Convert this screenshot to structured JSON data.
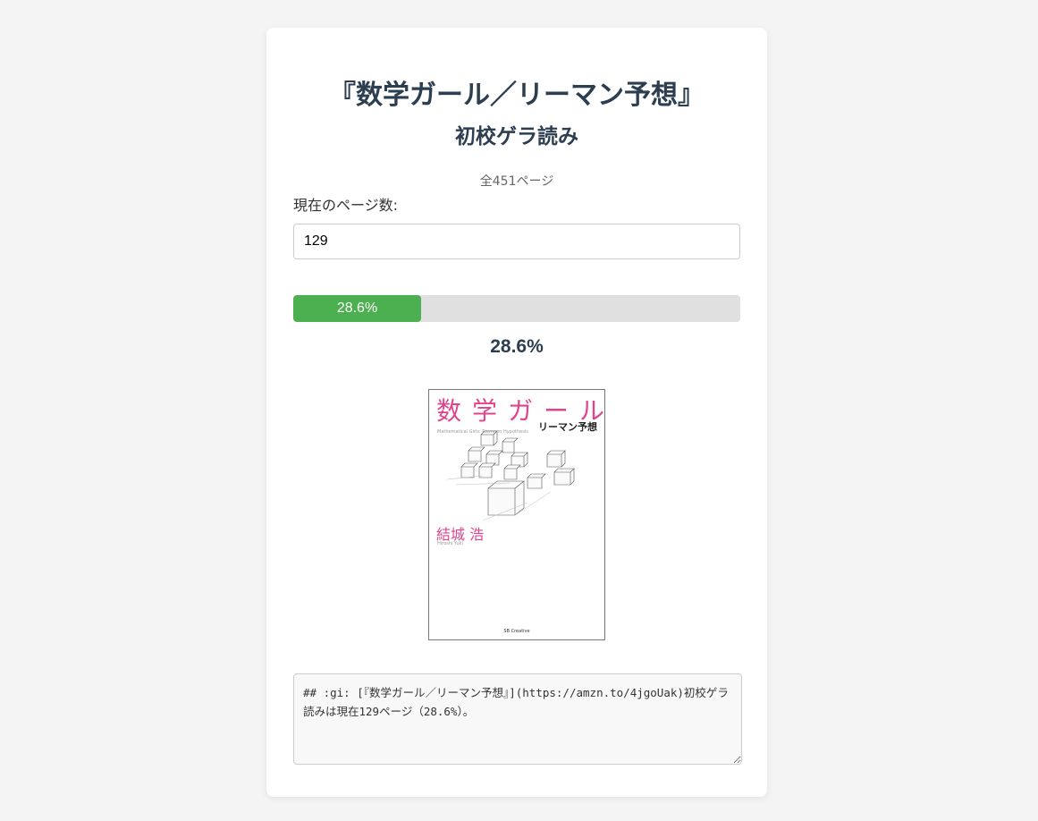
{
  "header": {
    "title": "『数学ガール／リーマン予想』",
    "subtitle": "初校ゲラ読み"
  },
  "book": {
    "total_pages_text": "全451ページ",
    "current_page_label": "現在のページ数:",
    "current_page_value": "129"
  },
  "progress": {
    "percent_value": 28.6,
    "bar_label": "28.6%",
    "percent_text": "28.6%"
  },
  "cover": {
    "title": "数学ガール",
    "subtitle": "リーマン予想",
    "title_en": "Mathematical Girls: Riemann Hypothesis",
    "author": "結城 浩",
    "author_en": "Hiroshi Yuki",
    "publisher": "SB Creative"
  },
  "output": {
    "text": "## :gi: [『数学ガール／リーマン予想』](https://amzn.to/4jgoUak)初校ゲラ読みは現在129ページ（28.6%）。"
  },
  "colors": {
    "progress_fill": "#4caf50",
    "progress_track": "#e0e0e0",
    "title_color": "#2c3e50",
    "cover_accent": "#e0458c"
  }
}
